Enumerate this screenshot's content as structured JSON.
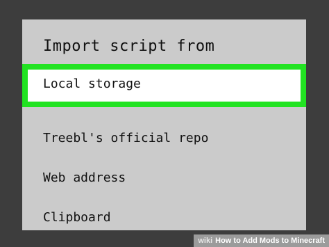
{
  "dialog": {
    "title": "Import script from",
    "options": [
      {
        "label": "Local storage",
        "selected": true
      },
      {
        "label": "Treebl's official repo",
        "selected": false
      },
      {
        "label": "Web address",
        "selected": false
      },
      {
        "label": "Clipboard",
        "selected": false
      }
    ]
  },
  "watermark": {
    "brand": "wiki",
    "text": "How to Add Mods to Minecraft"
  },
  "colors": {
    "highlight_border": "#22e322",
    "dialog_bg": "#cbcbcb",
    "backdrop": "#3d3d3d"
  }
}
